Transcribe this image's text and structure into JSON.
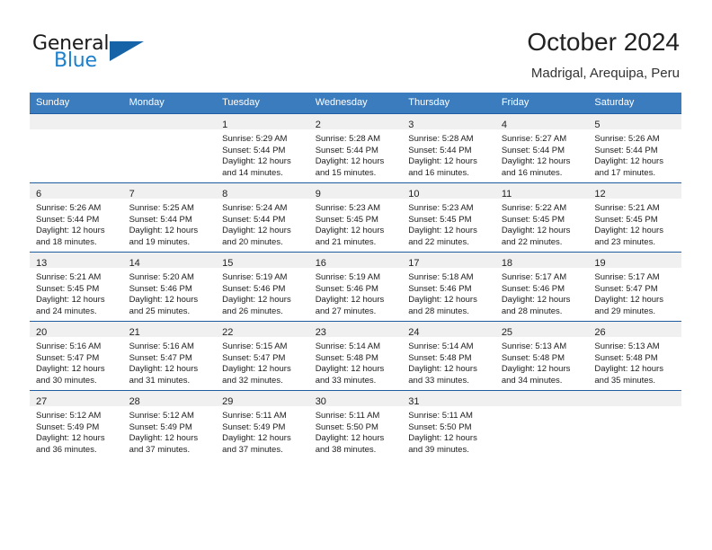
{
  "brand": {
    "name_top": "General",
    "name_bottom": "Blue",
    "triangle_color": "#1663a8",
    "blue_color": "#1b7fcc"
  },
  "header": {
    "title": "October 2024",
    "subtitle": "Madrigal, Arequipa, Peru"
  },
  "theme": {
    "header_row_bg": "#3b7cbf",
    "row_divider": "#1f5d9e",
    "daynum_bg": "#f0f0f0"
  },
  "weekday_headers": [
    "Sunday",
    "Monday",
    "Tuesday",
    "Wednesday",
    "Thursday",
    "Friday",
    "Saturday"
  ],
  "weeks": [
    [
      {
        "day": "",
        "lines": []
      },
      {
        "day": "",
        "lines": []
      },
      {
        "day": "1",
        "lines": [
          "Sunrise: 5:29 AM",
          "Sunset: 5:44 PM",
          "Daylight: 12 hours",
          "and 14 minutes."
        ]
      },
      {
        "day": "2",
        "lines": [
          "Sunrise: 5:28 AM",
          "Sunset: 5:44 PM",
          "Daylight: 12 hours",
          "and 15 minutes."
        ]
      },
      {
        "day": "3",
        "lines": [
          "Sunrise: 5:28 AM",
          "Sunset: 5:44 PM",
          "Daylight: 12 hours",
          "and 16 minutes."
        ]
      },
      {
        "day": "4",
        "lines": [
          "Sunrise: 5:27 AM",
          "Sunset: 5:44 PM",
          "Daylight: 12 hours",
          "and 16 minutes."
        ]
      },
      {
        "day": "5",
        "lines": [
          "Sunrise: 5:26 AM",
          "Sunset: 5:44 PM",
          "Daylight: 12 hours",
          "and 17 minutes."
        ]
      }
    ],
    [
      {
        "day": "6",
        "lines": [
          "Sunrise: 5:26 AM",
          "Sunset: 5:44 PM",
          "Daylight: 12 hours",
          "and 18 minutes."
        ]
      },
      {
        "day": "7",
        "lines": [
          "Sunrise: 5:25 AM",
          "Sunset: 5:44 PM",
          "Daylight: 12 hours",
          "and 19 minutes."
        ]
      },
      {
        "day": "8",
        "lines": [
          "Sunrise: 5:24 AM",
          "Sunset: 5:44 PM",
          "Daylight: 12 hours",
          "and 20 minutes."
        ]
      },
      {
        "day": "9",
        "lines": [
          "Sunrise: 5:23 AM",
          "Sunset: 5:45 PM",
          "Daylight: 12 hours",
          "and 21 minutes."
        ]
      },
      {
        "day": "10",
        "lines": [
          "Sunrise: 5:23 AM",
          "Sunset: 5:45 PM",
          "Daylight: 12 hours",
          "and 22 minutes."
        ]
      },
      {
        "day": "11",
        "lines": [
          "Sunrise: 5:22 AM",
          "Sunset: 5:45 PM",
          "Daylight: 12 hours",
          "and 22 minutes."
        ]
      },
      {
        "day": "12",
        "lines": [
          "Sunrise: 5:21 AM",
          "Sunset: 5:45 PM",
          "Daylight: 12 hours",
          "and 23 minutes."
        ]
      }
    ],
    [
      {
        "day": "13",
        "lines": [
          "Sunrise: 5:21 AM",
          "Sunset: 5:45 PM",
          "Daylight: 12 hours",
          "and 24 minutes."
        ]
      },
      {
        "day": "14",
        "lines": [
          "Sunrise: 5:20 AM",
          "Sunset: 5:46 PM",
          "Daylight: 12 hours",
          "and 25 minutes."
        ]
      },
      {
        "day": "15",
        "lines": [
          "Sunrise: 5:19 AM",
          "Sunset: 5:46 PM",
          "Daylight: 12 hours",
          "and 26 minutes."
        ]
      },
      {
        "day": "16",
        "lines": [
          "Sunrise: 5:19 AM",
          "Sunset: 5:46 PM",
          "Daylight: 12 hours",
          "and 27 minutes."
        ]
      },
      {
        "day": "17",
        "lines": [
          "Sunrise: 5:18 AM",
          "Sunset: 5:46 PM",
          "Daylight: 12 hours",
          "and 28 minutes."
        ]
      },
      {
        "day": "18",
        "lines": [
          "Sunrise: 5:17 AM",
          "Sunset: 5:46 PM",
          "Daylight: 12 hours",
          "and 28 minutes."
        ]
      },
      {
        "day": "19",
        "lines": [
          "Sunrise: 5:17 AM",
          "Sunset: 5:47 PM",
          "Daylight: 12 hours",
          "and 29 minutes."
        ]
      }
    ],
    [
      {
        "day": "20",
        "lines": [
          "Sunrise: 5:16 AM",
          "Sunset: 5:47 PM",
          "Daylight: 12 hours",
          "and 30 minutes."
        ]
      },
      {
        "day": "21",
        "lines": [
          "Sunrise: 5:16 AM",
          "Sunset: 5:47 PM",
          "Daylight: 12 hours",
          "and 31 minutes."
        ]
      },
      {
        "day": "22",
        "lines": [
          "Sunrise: 5:15 AM",
          "Sunset: 5:47 PM",
          "Daylight: 12 hours",
          "and 32 minutes."
        ]
      },
      {
        "day": "23",
        "lines": [
          "Sunrise: 5:14 AM",
          "Sunset: 5:48 PM",
          "Daylight: 12 hours",
          "and 33 minutes."
        ]
      },
      {
        "day": "24",
        "lines": [
          "Sunrise: 5:14 AM",
          "Sunset: 5:48 PM",
          "Daylight: 12 hours",
          "and 33 minutes."
        ]
      },
      {
        "day": "25",
        "lines": [
          "Sunrise: 5:13 AM",
          "Sunset: 5:48 PM",
          "Daylight: 12 hours",
          "and 34 minutes."
        ]
      },
      {
        "day": "26",
        "lines": [
          "Sunrise: 5:13 AM",
          "Sunset: 5:48 PM",
          "Daylight: 12 hours",
          "and 35 minutes."
        ]
      }
    ],
    [
      {
        "day": "27",
        "lines": [
          "Sunrise: 5:12 AM",
          "Sunset: 5:49 PM",
          "Daylight: 12 hours",
          "and 36 minutes."
        ]
      },
      {
        "day": "28",
        "lines": [
          "Sunrise: 5:12 AM",
          "Sunset: 5:49 PM",
          "Daylight: 12 hours",
          "and 37 minutes."
        ]
      },
      {
        "day": "29",
        "lines": [
          "Sunrise: 5:11 AM",
          "Sunset: 5:49 PM",
          "Daylight: 12 hours",
          "and 37 minutes."
        ]
      },
      {
        "day": "30",
        "lines": [
          "Sunrise: 5:11 AM",
          "Sunset: 5:50 PM",
          "Daylight: 12 hours",
          "and 38 minutes."
        ]
      },
      {
        "day": "31",
        "lines": [
          "Sunrise: 5:11 AM",
          "Sunset: 5:50 PM",
          "Daylight: 12 hours",
          "and 39 minutes."
        ]
      },
      {
        "day": "",
        "lines": []
      },
      {
        "day": "",
        "lines": []
      }
    ]
  ]
}
